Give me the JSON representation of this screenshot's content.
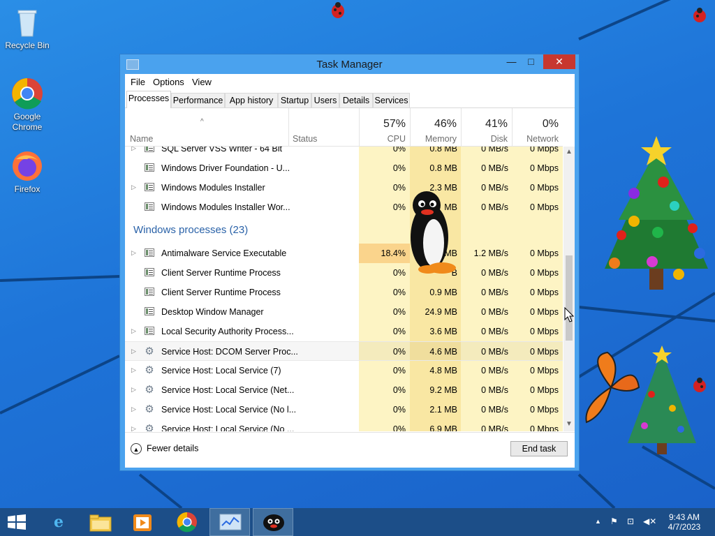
{
  "desktop": {
    "icons": [
      {
        "label": "Recycle Bin"
      },
      {
        "label": "Google Chrome"
      },
      {
        "label": "Firefox"
      }
    ]
  },
  "window": {
    "title": "Task Manager",
    "controls": {
      "minimize": "—",
      "maximize": "□",
      "close": "✕"
    }
  },
  "menu": {
    "items": [
      "File",
      "Options",
      "View"
    ]
  },
  "tabs": [
    "Processes",
    "Performance",
    "App history",
    "Startup",
    "Users",
    "Details",
    "Services"
  ],
  "columns": {
    "name": "Name",
    "status": "Status",
    "cpu": {
      "pct": "57%",
      "label": "CPU"
    },
    "memory": {
      "pct": "46%",
      "label": "Memory"
    },
    "disk": {
      "pct": "41%",
      "label": "Disk"
    },
    "network": {
      "pct": "0%",
      "label": "Network"
    }
  },
  "rows": [
    {
      "type": "process",
      "icon": "window-icon",
      "expand": true,
      "name": "SQL Server VSS Writer - 64 Bit",
      "cpu": "0%",
      "memory": "0.8 MB",
      "disk": "0 MB/s",
      "network": "0 Mbps"
    },
    {
      "type": "process",
      "icon": "window-icon",
      "expand": false,
      "name": "Windows Driver Foundation - U...",
      "cpu": "0%",
      "memory": "0.8 MB",
      "disk": "0 MB/s",
      "network": "0 Mbps"
    },
    {
      "type": "process",
      "icon": "window-icon",
      "expand": true,
      "name": "Windows Modules Installer",
      "cpu": "0%",
      "memory": "2.3 MB",
      "disk": "0 MB/s",
      "network": "0 Mbps"
    },
    {
      "type": "process",
      "icon": "window-icon",
      "expand": false,
      "name": "Windows Modules Installer Wor...",
      "cpu": "0%",
      "memory": "MB",
      "disk": "0 MB/s",
      "network": "0 Mbps"
    },
    {
      "type": "group",
      "name": "Windows processes (23)"
    },
    {
      "type": "process",
      "icon": "window-icon",
      "expand": true,
      "name": "Antimalware Service Executable",
      "cpu": "18.4%",
      "memory": "MB",
      "disk": "1.2 MB/s",
      "network": "0 Mbps"
    },
    {
      "type": "process",
      "icon": "window-icon",
      "expand": false,
      "name": "Client Server Runtime Process",
      "cpu": "0%",
      "memory": "B",
      "disk": "0 MB/s",
      "network": "0 Mbps"
    },
    {
      "type": "process",
      "icon": "window-icon",
      "expand": false,
      "name": "Client Server Runtime Process",
      "cpu": "0%",
      "memory": "0.9 MB",
      "disk": "0 MB/s",
      "network": "0 Mbps"
    },
    {
      "type": "process",
      "icon": "window-icon",
      "expand": false,
      "name": "Desktop Window Manager",
      "cpu": "0%",
      "memory": "24.9 MB",
      "disk": "0 MB/s",
      "network": "0 Mbps"
    },
    {
      "type": "process",
      "icon": "window-icon",
      "expand": true,
      "name": "Local Security Authority Process...",
      "cpu": "0%",
      "memory": "3.6 MB",
      "disk": "0 MB/s",
      "network": "0 Mbps"
    },
    {
      "type": "process",
      "icon": "gear-icon",
      "expand": true,
      "selected": true,
      "name": "Service Host: DCOM Server Proc...",
      "cpu": "0%",
      "memory": "4.6 MB",
      "disk": "0 MB/s",
      "network": "0 Mbps"
    },
    {
      "type": "process",
      "icon": "gear-icon",
      "expand": true,
      "name": "Service Host: Local Service (7)",
      "cpu": "0%",
      "memory": "4.8 MB",
      "disk": "0 MB/s",
      "network": "0 Mbps"
    },
    {
      "type": "process",
      "icon": "gear-icon",
      "expand": true,
      "name": "Service Host: Local Service (Net...",
      "cpu": "0%",
      "memory": "9.2 MB",
      "disk": "0 MB/s",
      "network": "0 Mbps"
    },
    {
      "type": "process",
      "icon": "gear-icon",
      "expand": true,
      "name": "Service Host: Local Service (No l...",
      "cpu": "0%",
      "memory": "2.1 MB",
      "disk": "0 MB/s",
      "network": "0 Mbps"
    },
    {
      "type": "process",
      "icon": "gear-icon",
      "expand": true,
      "name": "Service Host: Local Service (No ...",
      "cpu": "0%",
      "memory": "6.9 MB",
      "disk": "0 MB/s",
      "network": "0 Mbps"
    }
  ],
  "footer": {
    "fewer_details": "Fewer details",
    "end_task": "End task"
  },
  "taskbar": {
    "items": [
      "start-icon",
      "internet-explorer-icon",
      "file-explorer-icon",
      "media-player-icon",
      "chrome-icon",
      "task-manager-icon",
      "penguin-app-icon"
    ],
    "clock": {
      "time": "9:43 AM",
      "date": "4/7/2023"
    }
  },
  "colors": {
    "heat_light": "#fdf4c4",
    "heat_mid": "#f9e7a3",
    "heat_strong": "#fad48c",
    "group_text": "#2a62a8",
    "close_button": "#c7372f",
    "taskbar": "#1c4e88"
  }
}
